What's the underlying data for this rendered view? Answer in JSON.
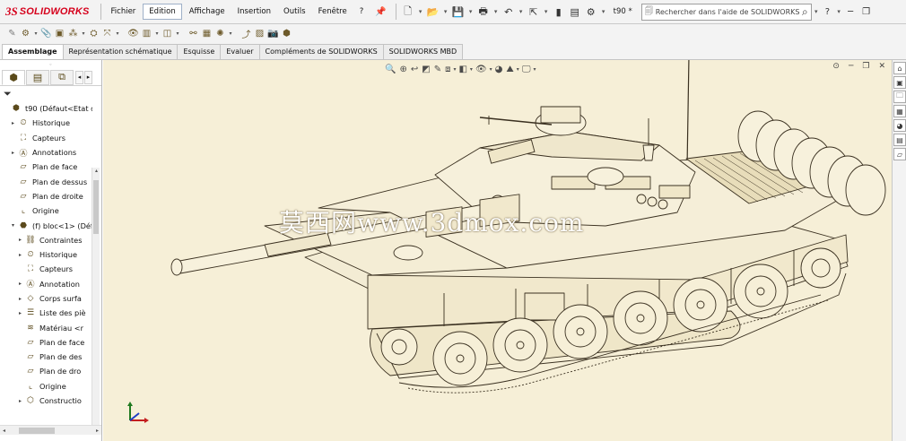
{
  "app": {
    "brand_ds": "3S",
    "brand_name": "SOLIDWORKS"
  },
  "menu": {
    "items": [
      "Fichier",
      "Edition",
      "Affichage",
      "Insertion",
      "Outils",
      "Fenêtre",
      "?"
    ],
    "active_index": 1
  },
  "toolbar": {
    "document_name": "t90 *"
  },
  "help_search": {
    "placeholder": "Rechercher dans l'aide de SOLIDWORKS"
  },
  "tabs": {
    "items": [
      "Assemblage",
      "Représentation schématique",
      "Esquisse",
      "Evaluer",
      "Compléments de SOLIDWORKS",
      "SOLIDWORKS MBD"
    ],
    "active_index": 0
  },
  "tree": {
    "items": [
      {
        "label": "t90  (Défaut<Etat d'a",
        "level": 0,
        "expander": "",
        "icon": "assembly-icon"
      },
      {
        "label": "Historique",
        "level": 1,
        "expander": "▸",
        "icon": "history-icon"
      },
      {
        "label": "Capteurs",
        "level": 1,
        "expander": "",
        "icon": "sensors-icon"
      },
      {
        "label": "Annotations",
        "level": 1,
        "expander": "▸",
        "icon": "annotations-icon"
      },
      {
        "label": "Plan de face",
        "level": 1,
        "expander": "",
        "icon": "plane-icon"
      },
      {
        "label": "Plan de dessus",
        "level": 1,
        "expander": "",
        "icon": "plane-icon"
      },
      {
        "label": "Plan de droite",
        "level": 1,
        "expander": "",
        "icon": "plane-icon"
      },
      {
        "label": "Origine",
        "level": 1,
        "expander": "",
        "icon": "origin-icon"
      },
      {
        "label": "(f) bloc<1> (Déf",
        "level": 1,
        "expander": "▾",
        "icon": "part-icon"
      },
      {
        "label": "Contraintes",
        "level": 2,
        "expander": "▸",
        "icon": "mates-icon"
      },
      {
        "label": "Historique",
        "level": 2,
        "expander": "▸",
        "icon": "history-icon"
      },
      {
        "label": "Capteurs",
        "level": 2,
        "expander": "",
        "icon": "sensors-icon"
      },
      {
        "label": "Annotation",
        "level": 2,
        "expander": "▸",
        "icon": "annotations-icon"
      },
      {
        "label": "Corps surfa",
        "level": 2,
        "expander": "▸",
        "icon": "surface-bodies-icon"
      },
      {
        "label": "Liste des piè",
        "level": 2,
        "expander": "▸",
        "icon": "cut-list-icon"
      },
      {
        "label": "Matériau <r",
        "level": 2,
        "expander": "",
        "icon": "material-icon"
      },
      {
        "label": "Plan de face",
        "level": 2,
        "expander": "",
        "icon": "plane-icon"
      },
      {
        "label": "Plan de des",
        "level": 2,
        "expander": "",
        "icon": "plane-icon"
      },
      {
        "label": "Plan de dro",
        "level": 2,
        "expander": "",
        "icon": "plane-icon"
      },
      {
        "label": "Origine",
        "level": 2,
        "expander": "",
        "icon": "origin-icon"
      },
      {
        "label": "Constructio",
        "level": 2,
        "expander": "▸",
        "icon": "feature-icon"
      }
    ]
  },
  "viewport": {
    "watermark": "莫西网www.3dmox.com",
    "background": "#f6efd7",
    "line_color": "#3a3020"
  },
  "colors": {
    "brand": "#d6001c",
    "active_tab_border": "#9fb0c8"
  }
}
